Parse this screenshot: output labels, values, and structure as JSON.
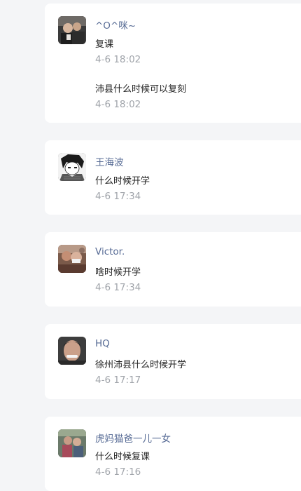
{
  "comments": [
    {
      "user": "^O^咪~",
      "avatar_icon": "user-photo-avatar",
      "messages": [
        {
          "text": "复课",
          "time": "4-6 18:02"
        },
        {
          "text": "沛县什么时候可以复刻",
          "time": "4-6 18:02"
        }
      ]
    },
    {
      "user": "王海波",
      "avatar_icon": "anime-character-avatar",
      "messages": [
        {
          "text": "什么时候开学",
          "time": "4-6 17:34"
        }
      ]
    },
    {
      "user": "Victor.",
      "avatar_icon": "user-photo-avatar",
      "messages": [
        {
          "text": "啥时候开学",
          "time": "4-6 17:34"
        }
      ]
    },
    {
      "user": "HQ",
      "avatar_icon": "user-photo-avatar",
      "messages": [
        {
          "text": "徐州沛县什么时候开学",
          "time": "4-6 17:17"
        }
      ]
    },
    {
      "user": "虎妈猫爸一儿一女",
      "avatar_icon": "user-photo-avatar",
      "messages": [
        {
          "text": "什么时候复课",
          "time": "4-6 17:16"
        }
      ]
    }
  ]
}
